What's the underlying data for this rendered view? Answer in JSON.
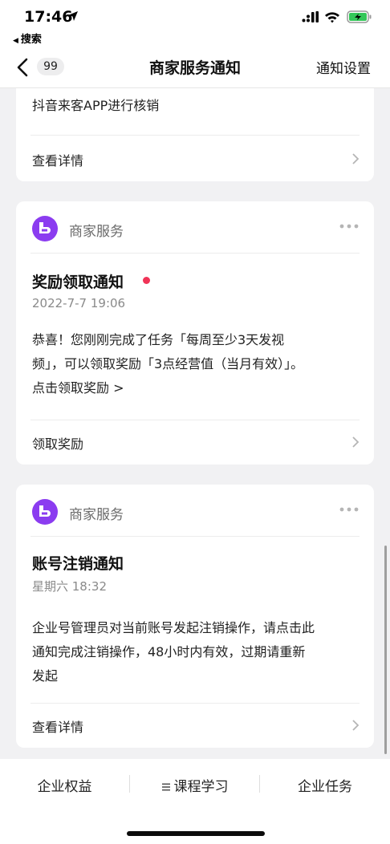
{
  "status_bar": {
    "time": "17:46",
    "back_app": "搜索",
    "battery_color": "#34c759"
  },
  "nav": {
    "badge": "99",
    "title": "商家服务通知",
    "setting": "通知设置"
  },
  "cards": [
    {
      "partial_text": "抖音来客APP进行核销",
      "action_label": "查看详情"
    },
    {
      "sender": "商家服务",
      "title": "奖励领取通知",
      "unread": true,
      "date": "2022-7-7 19:06",
      "body_lines": [
        "恭喜！您刚刚完成了任务「每周至少3天发视",
        "频」，可以领取奖励「3点经营值（当月有效）」。",
        "点击领取奖励 >"
      ],
      "action_label": "领取奖励"
    },
    {
      "sender": "商家服务",
      "title": "账号注销通知",
      "unread": false,
      "date": "星期六 18:32",
      "body_lines": [
        "企业号管理员对当前账号发起注销操作，请点击此",
        "通知完成注销操作，48小时内有效，过期请重新",
        "发起"
      ],
      "action_label": "查看详情"
    }
  ],
  "bottom_tabs": [
    {
      "label": "企业权益",
      "icon": "none"
    },
    {
      "label": "课程学习",
      "icon": "menu-lines-icon"
    },
    {
      "label": "企业任务",
      "icon": "none"
    }
  ],
  "colors": {
    "avatar": "#8b3cf0",
    "unread_dot": "#f03357",
    "background": "#f1f1f3"
  }
}
